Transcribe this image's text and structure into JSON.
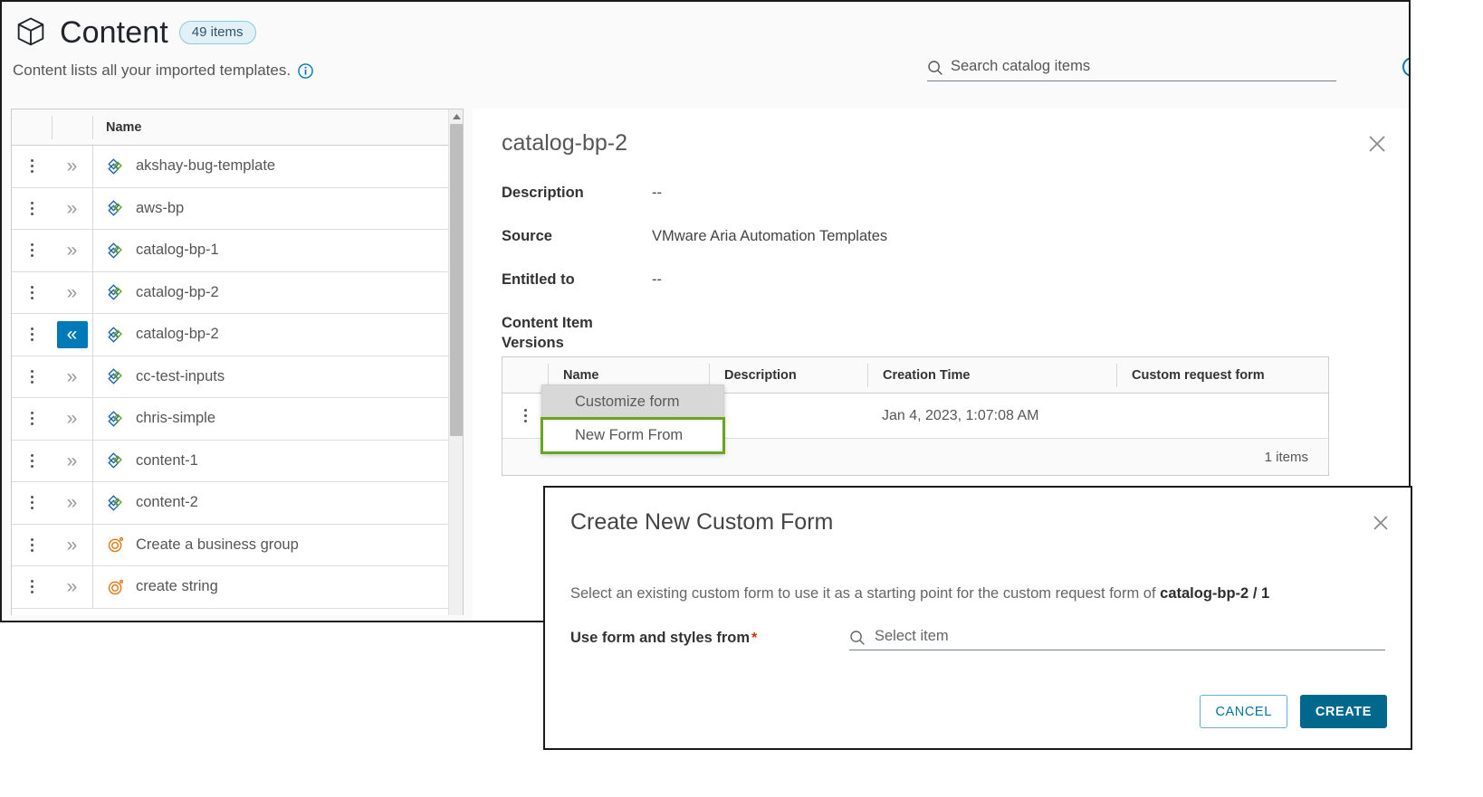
{
  "header": {
    "title": "Content",
    "icon": "box-icon",
    "count_badge": "49 items",
    "subtitle": "Content lists all your imported templates.",
    "info_icon": "info-icon"
  },
  "search": {
    "placeholder": "Search catalog items",
    "value": "",
    "icon": "search-icon"
  },
  "grid": {
    "columns": [
      "",
      "",
      "Name"
    ],
    "rows": [
      {
        "name": "akshay-bug-template",
        "type_icon": "blueprint-icon",
        "expanded": false
      },
      {
        "name": "aws-bp",
        "type_icon": "blueprint-icon",
        "expanded": false
      },
      {
        "name": "catalog-bp-1",
        "type_icon": "blueprint-icon",
        "expanded": false
      },
      {
        "name": "catalog-bp-2",
        "type_icon": "blueprint-icon",
        "expanded": false
      },
      {
        "name": "catalog-bp-2",
        "type_icon": "blueprint-icon",
        "expanded": true
      },
      {
        "name": "cc-test-inputs",
        "type_icon": "blueprint-icon",
        "expanded": false
      },
      {
        "name": "chris-simple",
        "type_icon": "blueprint-icon",
        "expanded": false
      },
      {
        "name": "content-1",
        "type_icon": "blueprint-icon",
        "expanded": false
      },
      {
        "name": "content-2",
        "type_icon": "blueprint-icon",
        "expanded": false
      },
      {
        "name": "Create a business group",
        "type_icon": "workflow-icon",
        "expanded": false
      },
      {
        "name": "create string",
        "type_icon": "workflow-icon",
        "expanded": false
      }
    ],
    "expand_glyph": "»",
    "collapse_glyph": "«"
  },
  "detail": {
    "title": "catalog-bp-2",
    "close_icon": "close-icon",
    "fields": [
      {
        "label": "Description",
        "value": "--"
      },
      {
        "label": "Source",
        "value": "VMware Aria Automation Templates"
      },
      {
        "label": "Entitled to",
        "value": "--"
      },
      {
        "label": "Content Item Versions",
        "value": ""
      }
    ]
  },
  "versions": {
    "columns": [
      "",
      "Name",
      "Description",
      "Creation Time",
      "Custom request form"
    ],
    "rows": [
      {
        "name": "",
        "description": "",
        "creation_time": "Jan 4, 2023, 1:07:08 AM",
        "custom_request_form": ""
      }
    ],
    "footer_count": "1 items"
  },
  "context_menu": {
    "items": [
      {
        "label": "Customize form",
        "state": "hovered"
      },
      {
        "label": "New Form From",
        "state": "highlighted"
      }
    ],
    "highlight_color": "#6aa521"
  },
  "modal": {
    "title": "Create New Custom Form",
    "close_icon": "close-icon",
    "description_prefix": "Select an existing custom form to use it as a starting point for the custom request form of ",
    "description_target": "catalog-bp-2 / 1",
    "field_label": "Use form and styles from",
    "required_marker": "*",
    "field_placeholder": "Select item",
    "field_value": "",
    "field_icon": "search-icon",
    "cancel_label": "CANCEL",
    "create_label": "CREATE"
  },
  "colors": {
    "accent_blue": "#0079b8",
    "primary_button": "#00678d",
    "highlight_green": "#6aa521",
    "badge_border": "#89cbdf",
    "badge_fill": "#e1f1f6",
    "required_red": "#e62700",
    "workflow_orange": "#e8740c",
    "blueprint_blue": "#1d63b0",
    "blueprint_green": "#62a420"
  }
}
